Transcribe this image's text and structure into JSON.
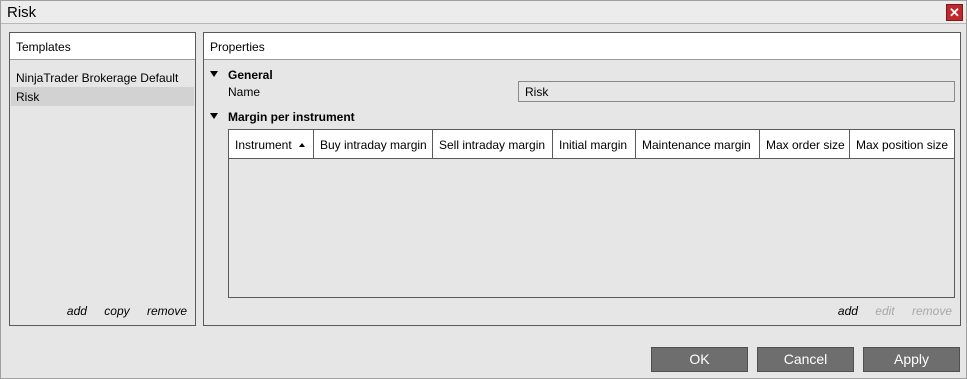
{
  "window": {
    "title": "Risk",
    "close_glyph": "✕"
  },
  "templates": {
    "header": "Templates",
    "items": [
      "NinjaTrader Brokerage Default",
      "Risk"
    ],
    "selected_index": 1,
    "links": {
      "add": "add",
      "copy": "copy",
      "remove": "remove"
    }
  },
  "properties": {
    "header": "Properties",
    "general": {
      "section_label": "General",
      "name_label": "Name",
      "name_value": "Risk"
    },
    "margin": {
      "section_label": "Margin per instrument",
      "columns": [
        "Instrument",
        "Buy intraday margin",
        "Sell intraday margin",
        "Initial margin",
        "Maintenance margin",
        "Max order size",
        "Max position size"
      ],
      "sort_column": "Instrument",
      "sort_direction": "ascending",
      "rows": [],
      "links": {
        "add": "add",
        "edit": "edit",
        "remove": "remove"
      },
      "disabled_links": [
        "edit",
        "remove"
      ]
    }
  },
  "buttons": {
    "ok": "OK",
    "cancel": "Cancel",
    "apply": "Apply"
  },
  "colors": {
    "close_button": "#c0282d",
    "dialog_button": "#6e6e6e",
    "selection": "#d2d2d2"
  }
}
